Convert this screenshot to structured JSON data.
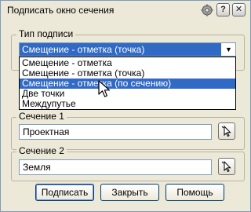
{
  "window": {
    "title": "Подписать окно сечения",
    "help_label": "?",
    "close_label": "✕"
  },
  "label_type": {
    "group_label": "Тип подписи",
    "selected_value": "Смещение - отметка (точка)",
    "options": [
      "Смещение - отметка",
      "Смещение - отметка (точка)",
      "Смещение - отметка (по сечению)",
      "Две точки",
      "Междупутье"
    ],
    "highlighted_index": 2
  },
  "section1": {
    "label": "Сечение 1",
    "value": "Проектная"
  },
  "section2": {
    "label": "Сечение 2",
    "value": "Земля"
  },
  "buttons": {
    "sign": "Подписать",
    "close": "Закрыть",
    "help": "Помощь"
  },
  "icons": {
    "gear": "gear-icon",
    "help": "help-icon",
    "close": "close-icon",
    "pick": "cursor-pick-icon",
    "dropdown": "chevron-down-icon"
  },
  "colors": {
    "selection": "#316ac5",
    "window_bg": "#ece9d8"
  }
}
